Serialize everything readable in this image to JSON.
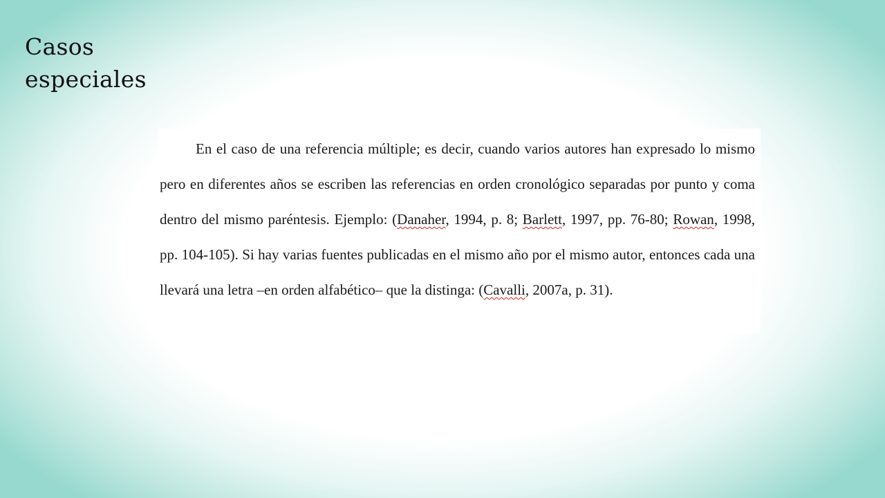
{
  "slide": {
    "title_line1": "Casos",
    "title_line2": "especiales"
  },
  "document": {
    "parts": [
      "En el caso de una referencia múltiple; es decir, cuando varios autores han expresado lo mismo pero en diferentes años se escriben las referencias en orden cronológico separadas por punto y coma dentro del mismo paréntesis. Ejemplo: (",
      "Danaher",
      ", 1994, p. 8; ",
      "Barlett",
      ", 1997, pp. 76-80; ",
      "Rowan",
      ", 1998, pp. 104-105). Si hay varias fuentes publicadas en el mismo año por el mismo autor, entonces cada una llevará una letra –en orden alfabético– que la distinga: (",
      "Cavalli",
      ", 2007a, p. 31)."
    ]
  },
  "colors": {
    "spellcheck_underline": "#d02020",
    "frame_teal": "#98d9cf"
  }
}
